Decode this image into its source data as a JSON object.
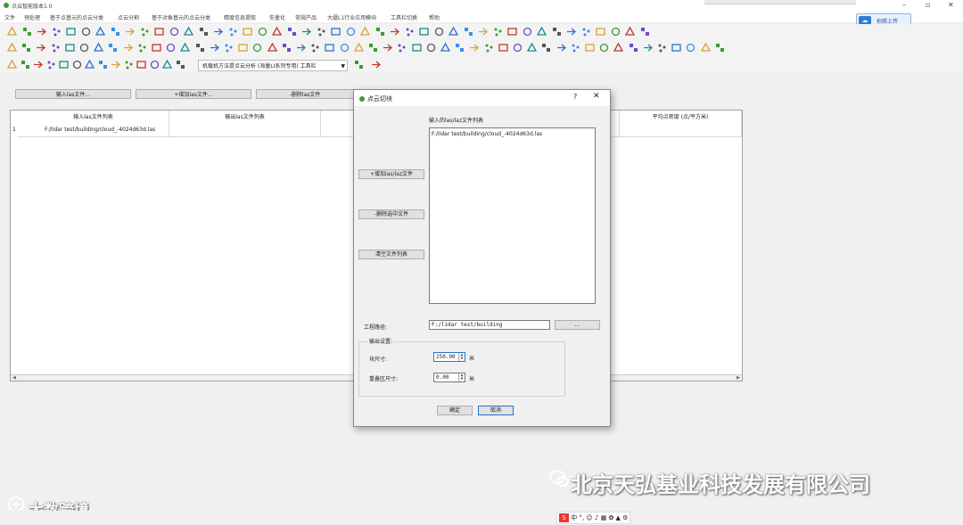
{
  "window": {
    "title": "点云智能版本1.0"
  },
  "menu": [
    "文件",
    "预处理",
    "基于点基元的点云分类",
    "点云分割",
    "基于对象基元的点云分类",
    "精度信息提取",
    "矢量化",
    "常规产品",
    "大疆L1行业应用模块",
    "工具栏切换",
    "帮助"
  ],
  "cloud_button": "拍照上传",
  "toolbar3": {
    "combo_value": "机载机方法提点云分析 (海量LI系列专用) 工具栏"
  },
  "main": {
    "buttons": {
      "input": "输入las文件...",
      "add": "+增加las文件...",
      "remove": "-删除las文件"
    },
    "table": {
      "headers": [
        "输入las文件列表",
        "输出las文件列表",
        "平均点密度 (点/平方米)"
      ],
      "rows": [
        {
          "index": "1",
          "input": "F:/lidar test/building/cloud_-4024d63d.las"
        }
      ]
    }
  },
  "dialog": {
    "title": "点云切块",
    "help": "?",
    "close": "✕",
    "list_label": "输入的las/laz文件列表",
    "files": [
      "F:/lidar test/building/cloud_-4024d63d.las"
    ],
    "add_button": "+增加las/laz文件",
    "remove_button": "-删除选中文件",
    "clear_button": "清空文件列表",
    "project_label": "工程路径:",
    "project_path": "F:/lidar test/building",
    "browse": "...",
    "output_group": "输出设置:",
    "block_label": "块尺寸:",
    "block_value": "250.00",
    "block_unit": "米",
    "overlap_label": "重叠区尺寸:",
    "overlap_value": "0.00",
    "overlap_unit": "米",
    "ok": "确定",
    "cancel": "取消"
  },
  "watermarks": {
    "company": "北京天弘基业科技发展有限公司",
    "brand": "大数跨境"
  },
  "tray": "中 °, ☺ ♪ ▦ ✿ ▲ ⚙"
}
